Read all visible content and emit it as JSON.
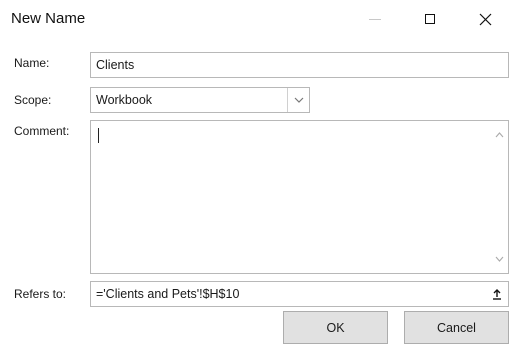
{
  "window": {
    "title": "New Name",
    "minimize_icon": "minimize-icon",
    "maximize_icon": "maximize-icon",
    "close_icon": "close-icon"
  },
  "form": {
    "name_label": "Name:",
    "name_value": "Clients",
    "scope_label": "Scope:",
    "scope_value": "Workbook",
    "comment_label": "Comment:",
    "comment_value": "",
    "refers_label": "Refers to:",
    "refers_value": "='Clients and Pets'!$H$10"
  },
  "buttons": {
    "ok_label": "OK",
    "cancel_label": "Cancel"
  }
}
